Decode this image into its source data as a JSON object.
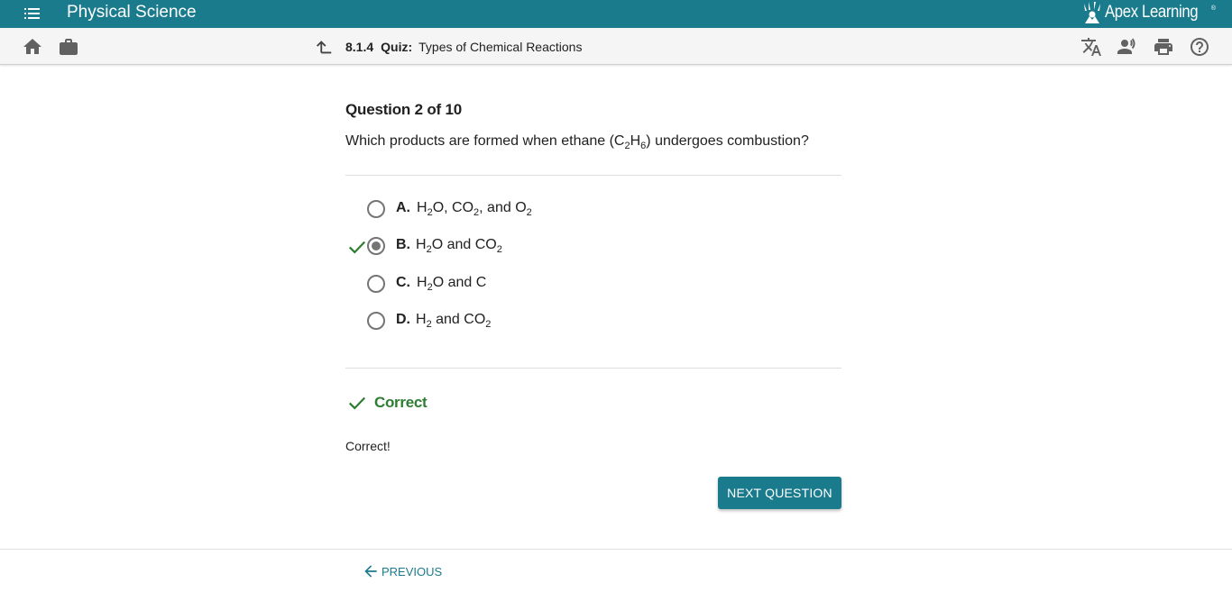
{
  "app": {
    "course_title": "Physical Science",
    "brand_name": "Apex Learning",
    "brand_tm": "®",
    "bar_color": "#1a7b8d"
  },
  "toolbar": {
    "left_icons": [
      "home-icon",
      "briefcase-icon"
    ],
    "breadcrumb": {
      "number": "8.1.4",
      "kind": "Quiz:",
      "title": "Types of Chemical Reactions"
    },
    "right_icons": [
      "translate-icon",
      "text-to-speech-icon",
      "print-icon",
      "help-icon"
    ]
  },
  "question": {
    "counter": "Question 2 of 10",
    "text": {
      "before": "Which products are formed when ethane (C",
      "sub1": "2",
      "mid": "H",
      "sub2": "6",
      "after": ") undergoes combustion?"
    }
  },
  "choices": [
    {
      "letter": "A.",
      "parts": [
        "H",
        "2",
        "O, CO",
        "2",
        ", and O",
        "2"
      ],
      "selected": false,
      "correct": false
    },
    {
      "letter": "B.",
      "parts": [
        "H",
        "2",
        "O and CO",
        "2"
      ],
      "selected": true,
      "correct": true
    },
    {
      "letter": "C.",
      "parts": [
        "H",
        "2",
        "O and C"
      ],
      "selected": false,
      "correct": false
    },
    {
      "letter": "D.",
      "parts": [
        "H",
        "2",
        " and CO",
        "2"
      ],
      "selected": false,
      "correct": false
    }
  ],
  "result": {
    "label": "Correct",
    "feedback": "Correct!",
    "color": "#2e7d32"
  },
  "buttons": {
    "next": "NEXT QUESTION",
    "previous": "PREVIOUS"
  }
}
